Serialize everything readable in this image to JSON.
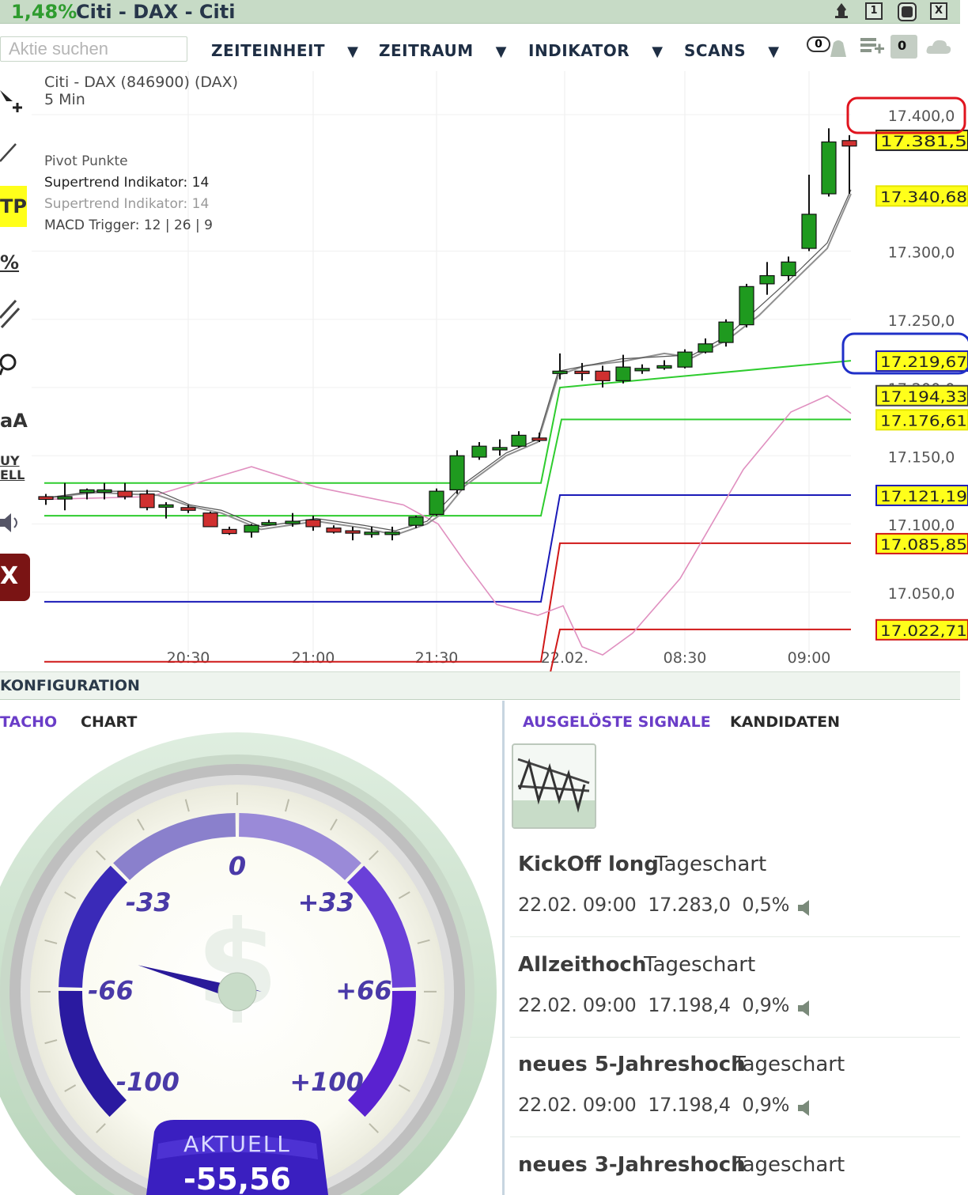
{
  "titlebar": {
    "percent": "1,48%",
    "title": "Citi - DAX - Citi",
    "btn_min": "1",
    "btn_close": "X"
  },
  "toolbar": {
    "search_placeholder": "Aktie suchen",
    "menus": [
      "ZEITEINHEIT",
      "ZEITRAUM",
      "INDIKATOR",
      "SCANS"
    ],
    "arrow": "▼",
    "badge1": "0",
    "badge2": "0"
  },
  "left_tools": {
    "tp": "TP",
    "percent": "%",
    "aa": "aA",
    "buy": "UY",
    "sell": "ELL",
    "x": "X"
  },
  "chart": {
    "instrument": "Citi - DAX (846900) (DAX)",
    "interval": "5 Min",
    "indicators": [
      "Pivot Punkte",
      "Supertrend Indikator: 14",
      "Supertrend Indikator: 14",
      "MACD Trigger: 12 | 26 | 9"
    ],
    "y_ticks": [
      "17.400,0",
      "17.300,0",
      "17.250,0",
      "17.200,0",
      "17.150,0",
      "17.100,0",
      "17.050,0"
    ],
    "x_ticks": [
      "20:30",
      "21:00",
      "21:30",
      "22.02.",
      "08:30",
      "09:00"
    ],
    "price_tags": [
      "17.381,5",
      "17.340,68",
      "17.219,67",
      "17.194,33",
      "17.176,61",
      "17.121,19",
      "17.085,85",
      "17.022,71"
    ],
    "colors": {
      "green": "#2ecc2e",
      "blue": "#1a1ab8",
      "red": "#d01818",
      "pink": "#e090c0",
      "candle_up": "#1f9a1f",
      "candle_down": "#d03030",
      "tag_yellow": "#ffff1a",
      "highlight_red": "#e0141e",
      "highlight_blue": "#2030c8"
    }
  },
  "config": {
    "label": "KONFIGURATION"
  },
  "tabs": {
    "left": [
      "TACHO",
      "CHART"
    ],
    "right": [
      "AUSGELÖSTE SIGNALE",
      "KANDIDATEN"
    ],
    "active_color": "#6a3dc8"
  },
  "gauge": {
    "labels": [
      "0",
      "-33",
      "+33",
      "-66",
      "+66",
      "-100",
      "+100"
    ],
    "aktuell_label": "AKTUELL",
    "aktuell_value": "-55,56",
    "value": -55.56
  },
  "signals": [
    {
      "name": "KickOff long",
      "chart": "Tageschart",
      "date": "22.02. 09:00",
      "price": "17.283,0",
      "pct": "0,5%"
    },
    {
      "name": "Allzeithoch",
      "chart": "Tageschart",
      "date": "22.02. 09:00",
      "price": "17.198,4",
      "pct": "0,9%"
    },
    {
      "name": "neues 5-Jahreshoch",
      "chart": "Tageschart",
      "date": "22.02. 09:00",
      "price": "17.198,4",
      "pct": "0,9%"
    },
    {
      "name": "neues 3-Jahreshoch",
      "chart": "Tageschart"
    }
  ]
}
